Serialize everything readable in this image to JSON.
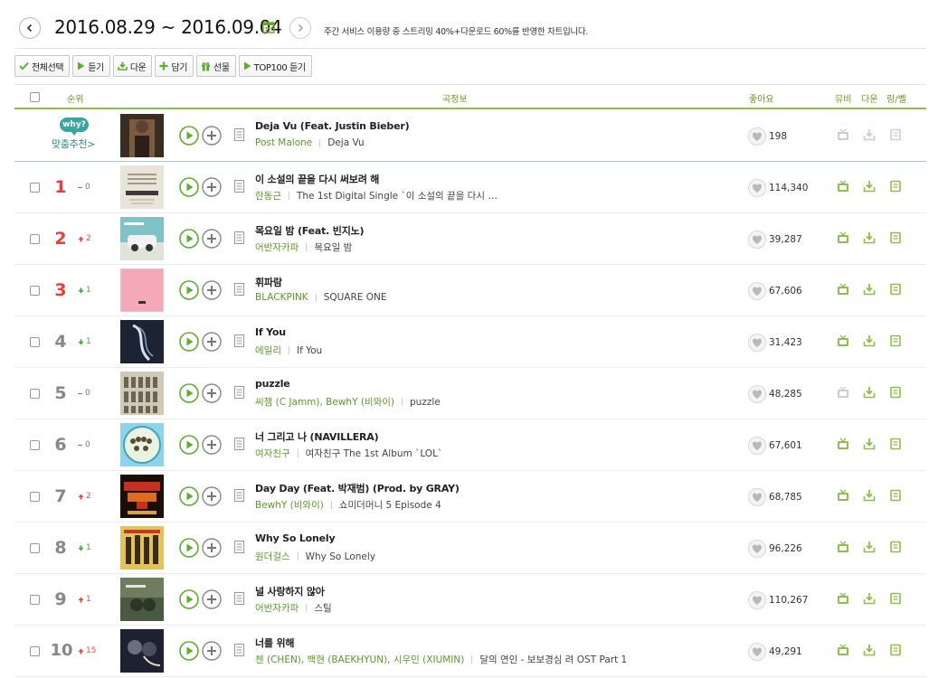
{
  "header": {
    "date_range": "2016.08.29 ~ 2016.09.04",
    "description": "주간 서비스 이용량 중 스트리밍 40%+다운로드 60%를 반영한 차트입니다."
  },
  "toolbar": {
    "select_all": "전체선택",
    "listen": "듣기",
    "download": "다운",
    "add": "담기",
    "gift": "선물",
    "top100": "TOP100 듣기"
  },
  "columns": {
    "rank": "순위",
    "song_info": "곡정보",
    "like": "좋아요",
    "mv": "뮤비",
    "download": "다운",
    "ring": "링/벨"
  },
  "recommend": {
    "why": "why?",
    "label": "맞춤추천",
    "title": "Deja Vu (Feat. Justin Bieber)",
    "artist": "Post Malone",
    "album": "Deja Vu",
    "likes": "198"
  },
  "songs": [
    {
      "rank": "1",
      "change": "0",
      "dir": "same",
      "title": "이 소설의 끝을 다시 써보려 해",
      "artist": "한동근",
      "album": "The 1st Digital Single `이 소설의 끝을 다시 …",
      "likes": "114,340"
    },
    {
      "rank": "2",
      "change": "2",
      "dir": "up",
      "title": "목요일 밤 (Feat. 빈지노)",
      "artist": "어반자카파",
      "album": "목요일 밤",
      "likes": "39,287"
    },
    {
      "rank": "3",
      "change": "1",
      "dir": "down",
      "title": "휘파람",
      "artist": "BLACKPINK",
      "album": "SQUARE ONE",
      "likes": "67,606"
    },
    {
      "rank": "4",
      "change": "1",
      "dir": "down",
      "title": "If You",
      "artist": "에일리",
      "album": "If You",
      "likes": "31,423"
    },
    {
      "rank": "5",
      "change": "0",
      "dir": "same",
      "title": "puzzle",
      "artist": "씨잼 (C Jamm), BewhY (비와이)",
      "album": "puzzle",
      "likes": "48,285"
    },
    {
      "rank": "6",
      "change": "0",
      "dir": "same",
      "title": "너 그리고 나 (NAVILLERA)",
      "artist": "여자친구",
      "album": "여자친구 The 1st Album `LOL`",
      "likes": "67,601"
    },
    {
      "rank": "7",
      "change": "2",
      "dir": "up",
      "title": "Day Day (Feat. 박재범) (Prod. by GRAY)",
      "artist": "BewhY (비와이)",
      "album": "쇼미더머니 5 Episode 4",
      "likes": "68,785"
    },
    {
      "rank": "8",
      "change": "1",
      "dir": "down",
      "title": "Why So Lonely",
      "artist": "원더걸스",
      "album": "Why So Lonely",
      "likes": "96,226"
    },
    {
      "rank": "9",
      "change": "1",
      "dir": "up",
      "title": "널 사랑하지 않아",
      "artist": "어반자카파",
      "album": "스틸",
      "likes": "110,267"
    },
    {
      "rank": "10",
      "change": "15",
      "dir": "up",
      "title": "너를 위해",
      "artist": "첸 (CHEN), 백현 (BAEKHYUN), 시우민 (XIUMIN)",
      "album": "달의 연인 - 보보경심 려 OST Part 1",
      "likes": "49,291"
    }
  ],
  "colors": {
    "accent_green": "#8dc63f",
    "play_green": "#5fae30",
    "rank_top": "#ee3b3b",
    "rank_default": "#888888",
    "up": "#e24b4b",
    "down": "#4da34d",
    "recommend_teal": "#39a6a0"
  },
  "icons": {
    "prev": "chevron-left-icon",
    "next": "chevron-right-icon",
    "calendar": "calendar-icon",
    "play": "play-icon",
    "add": "plus-icon",
    "lyrics": "document-icon",
    "like": "heart-icon",
    "mv": "tv-icon",
    "download": "download-icon",
    "ring": "bell-icon"
  }
}
